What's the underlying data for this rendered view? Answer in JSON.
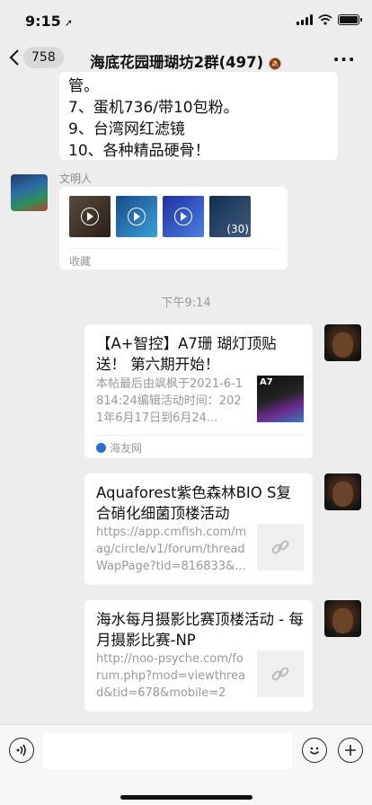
{
  "status": {
    "time": "9:15"
  },
  "nav": {
    "back_count": "758",
    "title": "海底花园珊瑚坊2群(497)"
  },
  "messages": {
    "text_lines": [
      "管。",
      "7、蛋机736/带10包粉。",
      "9、台湾网红滤镜",
      "10、各种精品硬骨！"
    ],
    "video": {
      "sender": "文明人",
      "more_count": "(30)",
      "source": "收藏"
    },
    "timestamp": "下午9:14",
    "links": [
      {
        "title": "【A+智控】A7珊 瑚灯顶贴送！ 第六期开始！",
        "desc": "本帖最后由飒枫于2021-6-1814:24编辑活动时间：2021年6月17日到6月24...",
        "thumb_label": "A7",
        "source": "海友网"
      },
      {
        "title": "Aquaforest紫色森林BIO S复合硝化细菌顶楼活动",
        "desc": "https://app.cmfish.com/mag/circle/v1/forum/threadWapPage?tid=816833&..."
      },
      {
        "title": "海水每月摄影比赛顶楼活动 - 每月摄影比赛-NP",
        "desc": "http://noo-psyche.com/forum.php?mod=viewthread&tid=678&mobile=2"
      }
    ]
  },
  "icons": [
    "location-arrow-icon",
    "signal-icon",
    "wifi-icon",
    "battery-icon",
    "back-chevron-icon",
    "mute-icon",
    "more-icon",
    "play-icon",
    "link-icon",
    "voice-icon",
    "emoji-icon",
    "plus-icon"
  ]
}
